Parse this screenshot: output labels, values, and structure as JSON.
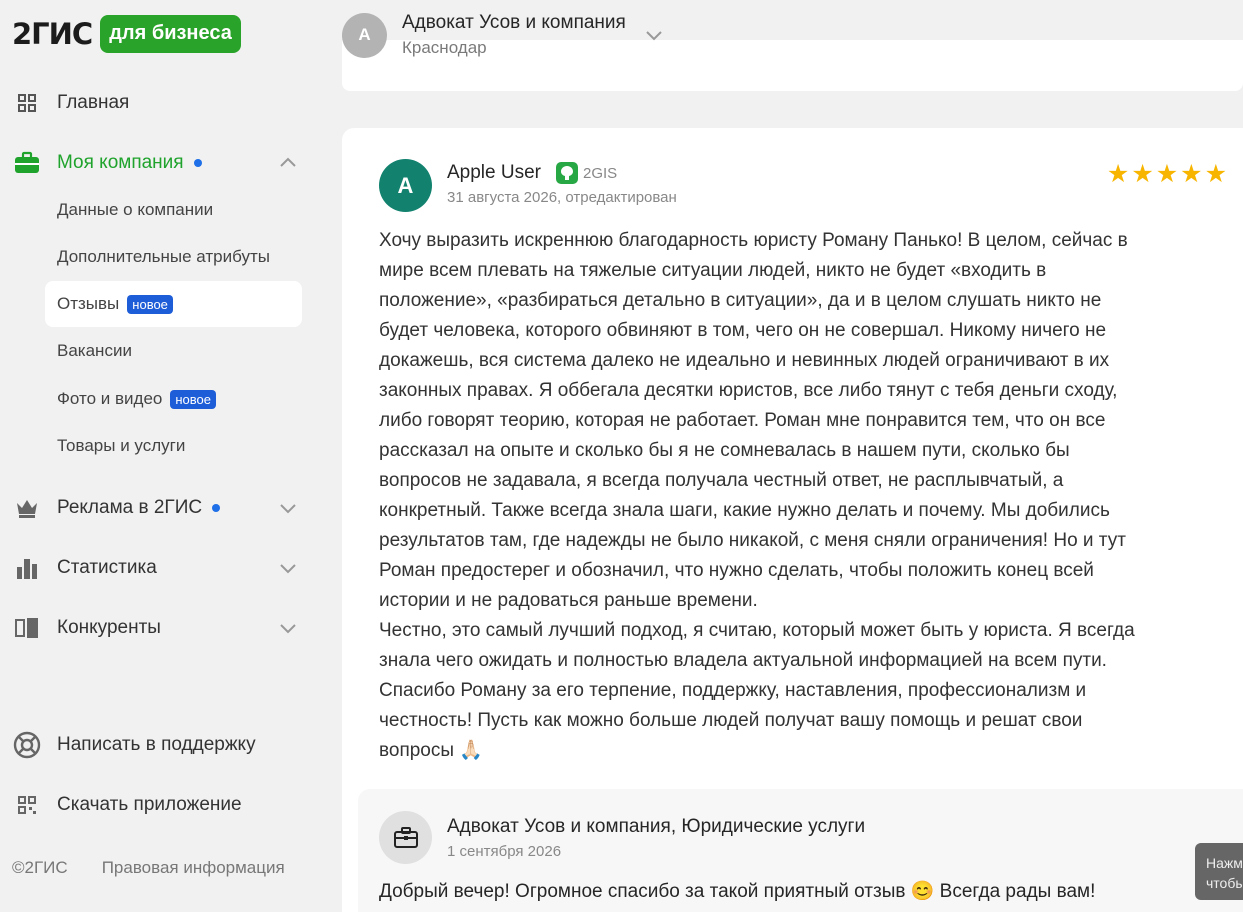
{
  "logo": {
    "text": "2ГИС",
    "badge": "для бизнеса"
  },
  "nav": {
    "home": "Главная",
    "company": "Моя компания",
    "company_sub": [
      {
        "label": "Данные о компании"
      },
      {
        "label": "Дополнительные атрибуты"
      },
      {
        "label": "Отзывы",
        "badge": "новое"
      },
      {
        "label": "Вакансии"
      },
      {
        "label": "Фото и видео",
        "badge": "новое"
      },
      {
        "label": "Товары и услуги"
      }
    ],
    "ads": "Реклама в 2ГИС",
    "stats": "Статистика",
    "competitors": "Конкуренты",
    "support": "Написать в поддержку",
    "download": "Скачать приложение"
  },
  "footer": {
    "copyright": "©2ГИС",
    "legal": "Правовая информация"
  },
  "header": {
    "avatar_letter": "А",
    "title": "Адвокат Усов и компания",
    "city": "Краснодар"
  },
  "review": {
    "avatar_letter": "A",
    "author": "Apple User",
    "source": "2GIS",
    "date": "31 августа 2026, отредактирован",
    "rating": 5,
    "text": "Хочу выразить искреннюю благодарность юристу Роману Панько! В целом, сейчас в\nмире всем плевать на тяжелые ситуации людей, никто не будет «входить в\nположение», «разбираться детально в ситуации», да и в целом слушать никто не\nбудет человека, которого обвиняют в том, чего он не совершал. Никому ничего не\nдокажешь, вся система далеко не идеально и невинных людей ограничивают в их\nзаконных правах. Я оббегала десятки юристов, все либо тянут с тебя деньги сходу,\nлибо говорят теорию, которая не работает. Роман мне понравится тем, что он все\nрассказал на опыте и сколько бы я не сомневалась в нашем пути, сколько бы\nвопросов не задавала, я всегда получала честный ответ, не расплывчатый, а\nконкретный. Также всегда знала шаги, какие нужно делать и почему. Мы добились\nрезультатов там, где надежды не было никакой, с меня сняли ограничения! Но и тут\nРоман предостерег и обозначил, что нужно сделать, чтобы положить конец всей\nистории и не радоваться раньше времени.\nЧестно, это самый лучший подход, я считаю, который может быть у юриста. Я всегда\nзнала чего ожидать и полностью владела актуальной информацией на всем пути.\nСпасибо Роману за его терпение, поддержку, наставления, профессионализм и\nчестность! Пусть как можно больше людей получат вашу помощь и решат свои\nвопросы 🙏🏻"
  },
  "reply": {
    "author": "Адвокат Усов и компания, Юридические услуги",
    "date": "1 сентября 2026",
    "text": "Добрый вечер! Огромное спасибо за такой приятный отзыв 😊 Всегда рады вам!"
  },
  "tooltip": {
    "line1": "Нажм",
    "line2": "чтобы"
  }
}
